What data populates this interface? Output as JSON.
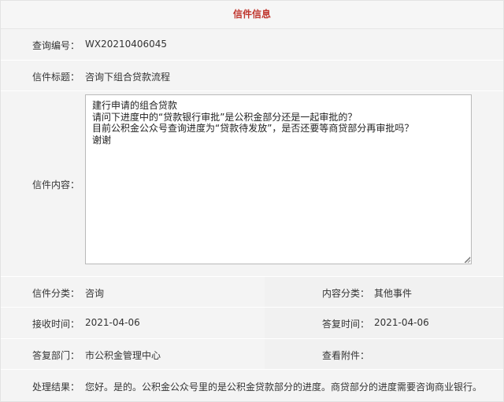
{
  "header": {
    "title": "信件信息"
  },
  "fields": {
    "query_no": {
      "label": "查询编号：",
      "value": "WX20210406045"
    },
    "subject": {
      "label": "信件标题：",
      "value": "咨询下组合贷款流程"
    },
    "content": {
      "label": "信件内容：",
      "value": "建行申请的组合贷款\n请问下进度中的“贷款银行审批”是公积金部分还是一起审批的？\n目前公积金公众号查询进度为“贷款待发放”，是否还要等商贷部分再审批吗？\n谢谢"
    },
    "category": {
      "label": "信件分类：",
      "value": "咨询"
    },
    "content_category": {
      "label": "内容分类：",
      "value": "其他事件"
    },
    "received_time": {
      "label": "接收时间：",
      "value": "2021-04-06"
    },
    "reply_time": {
      "label": "答复时间：",
      "value": "2021-04-06"
    },
    "reply_dept": {
      "label": "答复部门：",
      "value": "市公积金管理中心"
    },
    "attachments": {
      "label": "查看附件：",
      "value": ""
    },
    "result": {
      "label": "处理结果：",
      "value": "您好。是的。公积金公众号里的是公积金贷款部分的进度。商贷部分的进度需要咨询商业银行。"
    }
  }
}
